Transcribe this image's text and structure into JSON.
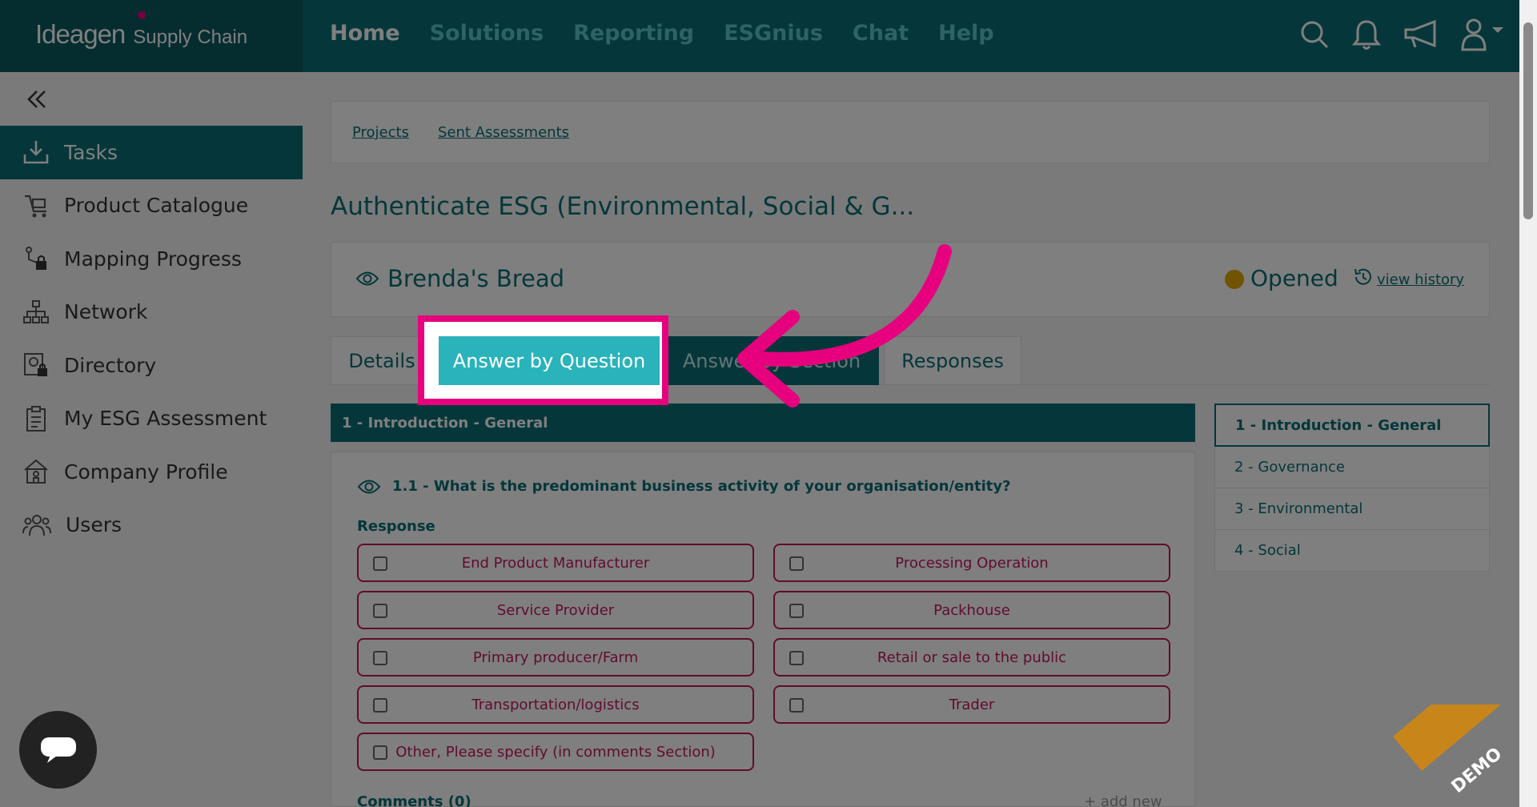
{
  "app": {
    "brand": "Ideagen",
    "product": "Supply Chain"
  },
  "topnav": {
    "links": [
      "Home",
      "Solutions",
      "Reporting",
      "ESGnius",
      "Chat",
      "Help"
    ]
  },
  "sidebar": {
    "items": [
      {
        "label": "Tasks",
        "icon": "download-tray-icon"
      },
      {
        "label": "Product Catalogue",
        "icon": "cart-icon"
      },
      {
        "label": "Mapping Progress",
        "icon": "mapping-lock-icon"
      },
      {
        "label": "Network",
        "icon": "network-icon"
      },
      {
        "label": "Directory",
        "icon": "directory-lock-icon"
      },
      {
        "label": "My ESG Assessment",
        "icon": "clipboard-icon"
      },
      {
        "label": "Company Profile",
        "icon": "building-icon"
      },
      {
        "label": "Users",
        "icon": "users-icon"
      }
    ]
  },
  "breadcrumb": [
    "Projects",
    "Sent Assessments"
  ],
  "page": {
    "title": "Authenticate ESG (Environmental, Social & G..."
  },
  "supplier": {
    "name": "Brenda's Bread",
    "status": "Opened",
    "status_color": "#e0a800",
    "history_link": "view history"
  },
  "tabs": {
    "details": "Details",
    "answer_by_question": "Answer by Question",
    "answer_by_section": "Answer by Section",
    "responses": "Responses"
  },
  "section": {
    "title": "1 - Introduction - General"
  },
  "question": {
    "text": "1.1 - What is the predominant business activity of your organisation/entity?",
    "response_label": "Response",
    "options": [
      "End Product Manufacturer",
      "Processing Operation",
      "Service Provider",
      "Packhouse",
      "Primary producer/Farm",
      "Retail or sale to the public",
      "Transportation/logistics",
      "Trader",
      "Other, Please specify (in comments Section)"
    ],
    "comments_label": "Comments (0)",
    "add_new": "add new"
  },
  "toc": [
    "1 - Introduction - General",
    "2 - Governance",
    "3 - Environmental",
    "4 - Social"
  ],
  "demo": "DEMO",
  "colors": {
    "brand_teal": "#0b6e74",
    "accent_pink": "#e6007e",
    "option_red": "#c2185b"
  }
}
